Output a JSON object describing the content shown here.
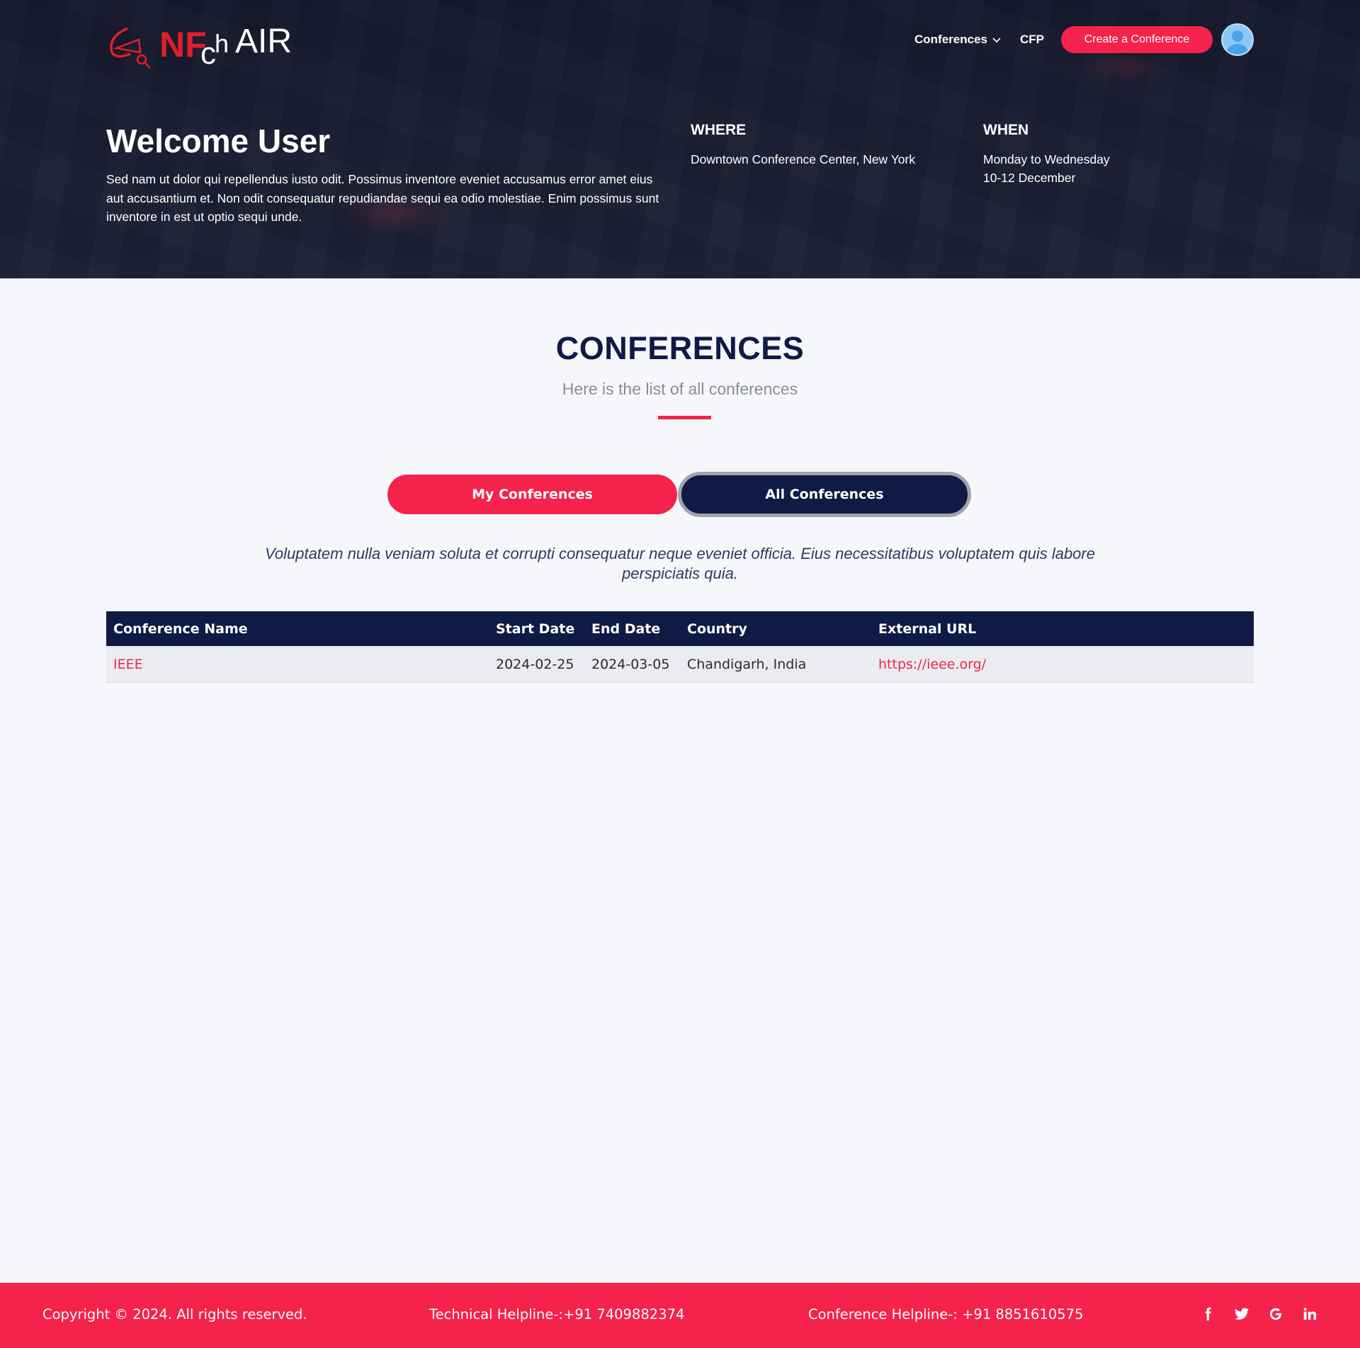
{
  "brand": {
    "logo_prefix": "NF",
    "logo_suffix": "AIR",
    "logo_c": "c",
    "logo_h": "h"
  },
  "nav": {
    "conferences_label": "Conferences",
    "cfp_label": "CFP",
    "create_label": "Create a Conference"
  },
  "hero": {
    "title": "Welcome User",
    "text": "Sed nam ut dolor qui repellendus iusto odit. Possimus inventore eveniet accusamus error amet eius aut accusantium et. Non odit consequatur repudiandae sequi ea odio molestiae. Enim possimus sunt inventore in est ut optio sequi unde.",
    "where_heading": "WHERE",
    "where_value": "Downtown Conference Center, New York",
    "when_heading": "WHEN",
    "when_line1": "Monday to Wednesday",
    "when_line2": "10-12 December"
  },
  "section": {
    "title": "CONFERENCES",
    "subtitle": "Here is the list of all conferences"
  },
  "tabs": {
    "my_label": "My Conferences",
    "all_label": "All Conferences"
  },
  "lead": "Voluptatem nulla veniam soluta et corrupti consequatur neque eveniet officia. Eius necessitatibus voluptatem quis labore perspiciatis quia.",
  "table": {
    "headers": [
      "Conference Name",
      "Start Date",
      "End Date",
      "Country",
      "External URL"
    ],
    "rows": [
      [
        "IEEE",
        "2024-02-25",
        "2024-03-05",
        "Chandigarh, India",
        "https://ieee.org/"
      ]
    ]
  },
  "footer": {
    "copyright": "Copyright © 2024. All rights reserved.",
    "technical": "Technical Helpline-:+91 7409882374",
    "conference": "Conference Helpline-: +91 8851610575",
    "socials": [
      "facebook-icon",
      "twitter-icon",
      "google-icon",
      "linkedin-icon"
    ]
  },
  "colors": {
    "accent": "#f5224b",
    "navy": "#0f1a45"
  }
}
